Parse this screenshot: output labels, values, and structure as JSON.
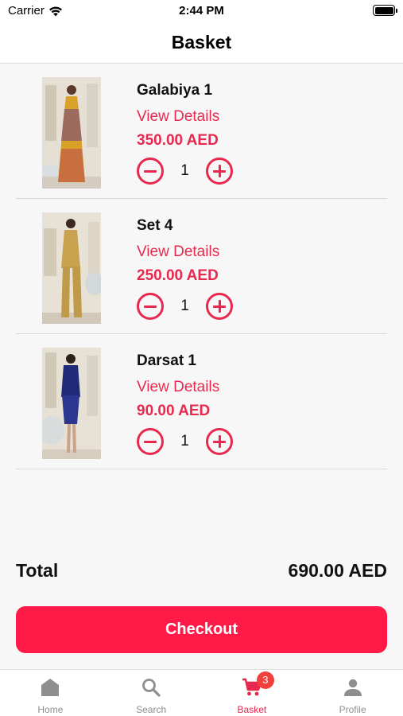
{
  "status_bar": {
    "carrier": "Carrier",
    "time": "2:44 PM"
  },
  "nav": {
    "title": "Basket"
  },
  "items": [
    {
      "name": "Galabiya 1",
      "details_label": "View Details",
      "price": "350.00 AED",
      "quantity": "1"
    },
    {
      "name": "Set 4",
      "details_label": "View Details",
      "price": "250.00 AED",
      "quantity": "1"
    },
    {
      "name": "Darsat 1",
      "details_label": "View Details",
      "price": "90.00 AED",
      "quantity": "1"
    }
  ],
  "summary": {
    "total_label": "Total",
    "total_amount": "690.00 AED"
  },
  "checkout": {
    "label": "Checkout"
  },
  "tabs": [
    {
      "label": "Home",
      "icon": "home-icon"
    },
    {
      "label": "Search",
      "icon": "search-icon"
    },
    {
      "label": "Basket",
      "icon": "cart-icon",
      "badge": "3",
      "active": true
    },
    {
      "label": "Profile",
      "icon": "person-icon"
    }
  ],
  "colors": {
    "accent": "#e8294f",
    "checkout_bg": "#ff1a47",
    "badge": "#f0413f"
  }
}
